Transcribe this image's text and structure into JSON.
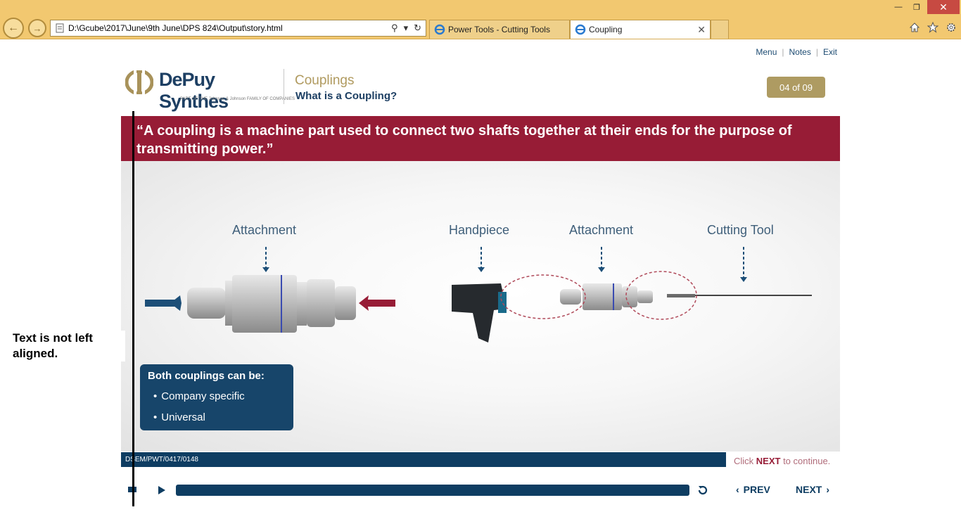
{
  "browser": {
    "address": "D:\\Gcube\\2017\\June\\9th June\\DPS 824\\Output\\story.html",
    "tabs": [
      {
        "label": "Power Tools - Cutting Tools",
        "active": false
      },
      {
        "label": "Coupling",
        "active": true
      }
    ],
    "window_controls": {
      "minimize": "—",
      "maximize": "❐",
      "close": "✕"
    },
    "icons": [
      "home-icon",
      "star-icon",
      "gear-icon"
    ]
  },
  "top_links": [
    "Menu",
    "Notes",
    "Exit"
  ],
  "logo": {
    "brand": "DePuy Synthes",
    "tagline": "PART OF THE Johnson & Johnson FAMILY OF COMPANIES"
  },
  "course": {
    "title": "Couplings",
    "subtitle": "What is a Coupling?"
  },
  "page_counter": "04 of 09",
  "banner": "“A coupling is a machine part used to connect two shafts together at their ends for the purpose of transmitting power.”",
  "stage": {
    "labels": [
      "Attachment",
      "Handpiece",
      "Attachment",
      "Cutting Tool"
    ]
  },
  "info_box": {
    "title": "Both couplings can be:",
    "items": [
      "Company specific",
      "Universal"
    ]
  },
  "footer": {
    "code": "DSEM/PWT/0417/0148",
    "click_prefix": "Click ",
    "click_next": "NEXT",
    "click_suffix": " to continue."
  },
  "player": {
    "prev": "PREV",
    "next": "NEXT"
  },
  "annotation": "Text is not left aligned.",
  "colors": {
    "brand_blue": "#0e3d62",
    "brand_red": "#971c36",
    "brand_gold": "#ae9b62"
  }
}
